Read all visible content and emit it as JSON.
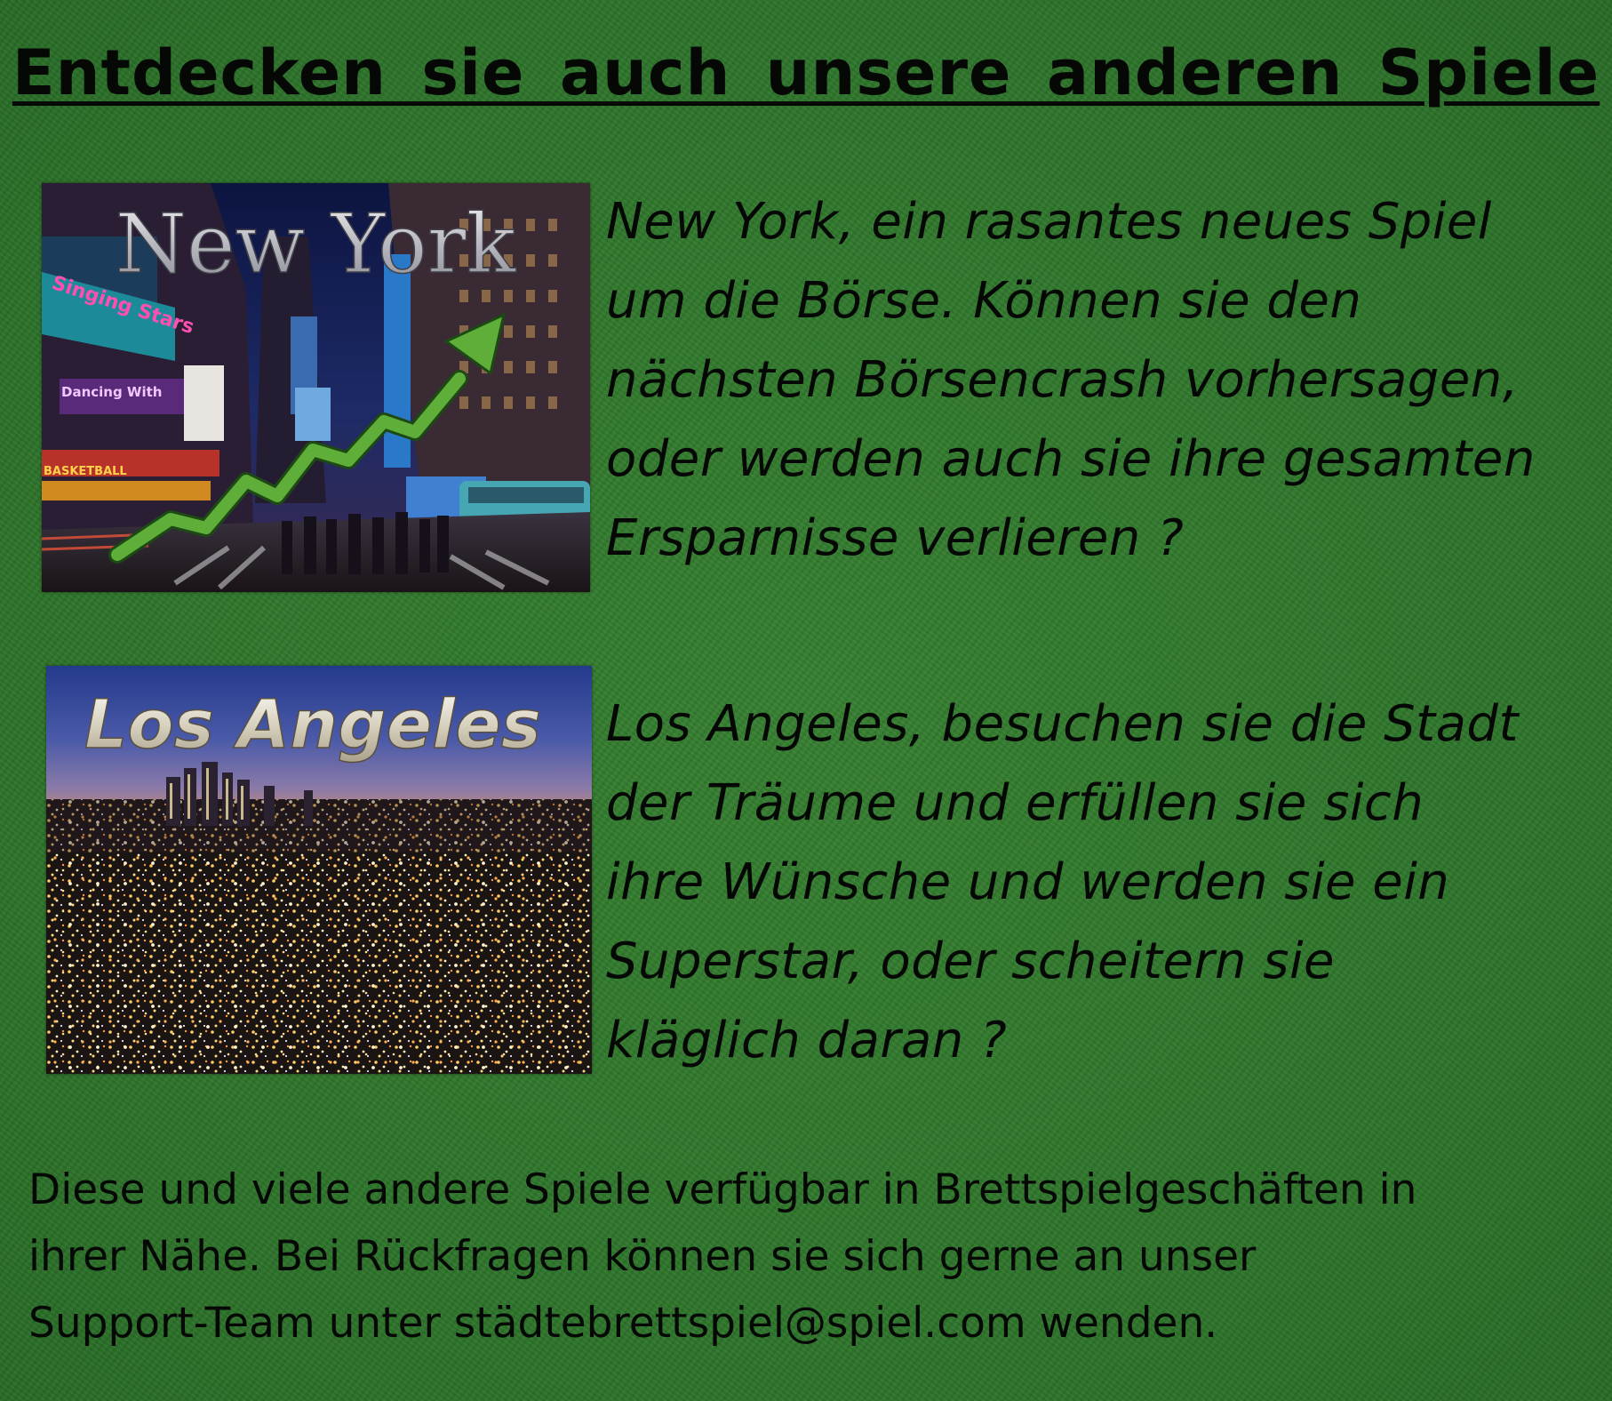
{
  "title": "Entdecken sie auch unsere anderen Spiele",
  "games": [
    {
      "image_title": "New York",
      "image_signs": [
        "Singing Stars",
        "Dancing With",
        "BASKETBALL"
      ],
      "description_lines": [
        "New York, ein rasantes neues Spiel",
        "um die Börse. Können sie den",
        "nächsten Börsencrash vorhersagen,",
        "oder werden auch sie ihre gesamten",
        "Ersparnisse verlieren ?"
      ]
    },
    {
      "image_title": "Los Angeles",
      "description_lines": [
        "Los Angeles, besuchen sie die Stadt",
        "der Träume und erfüllen sie sich",
        "ihre Wünsche und werden sie ein",
        "Superstar, oder scheitern sie",
        "kläglich daran ?"
      ]
    }
  ],
  "footer_lines": [
    "Diese und viele andere Spiele verfügbar in Brettspielgeschäften in",
    "ihrer Nähe. Bei Rückfragen können sie sich gerne an unser",
    "Support-Team unter städtebrettspiel@spiel.com wenden."
  ],
  "colors": {
    "background": "#2f7a2c",
    "text": "#060806",
    "chart_arrow": "#5fae3a"
  }
}
